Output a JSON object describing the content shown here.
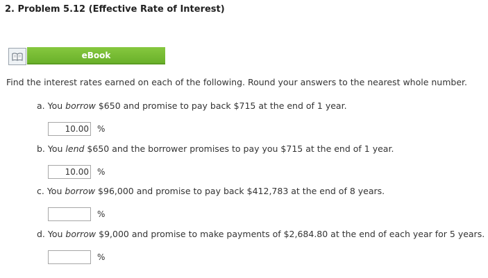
{
  "problem": {
    "title": "2. Problem 5.12 (Effective Rate of Interest)"
  },
  "ebook": {
    "label": "eBook",
    "icon": "book-icon"
  },
  "instructions": "Find the interest rates earned on each of the following. Round your answers to the nearest whole number.",
  "questions": [
    {
      "prefix": "a. You ",
      "verb": "borrow",
      "suffix": " $650 and promise to pay back $715 at the end of 1 year.",
      "answer_value": "10.00",
      "unit": "%"
    },
    {
      "prefix": "b. You ",
      "verb": "lend",
      "suffix": " $650 and the borrower promises to pay you $715 at the end of 1 year.",
      "answer_value": "10.00",
      "unit": "%"
    },
    {
      "prefix": "c. You ",
      "verb": "borrow",
      "suffix": " $96,000 and promise to pay back $412,783 at the end of 8 years.",
      "answer_value": "",
      "unit": "%"
    },
    {
      "prefix": "d. You ",
      "verb": "borrow",
      "suffix": " $9,000 and promise to make payments of $2,684.80 at the end of each year for 5 years.",
      "answer_value": "",
      "unit": "%"
    }
  ]
}
